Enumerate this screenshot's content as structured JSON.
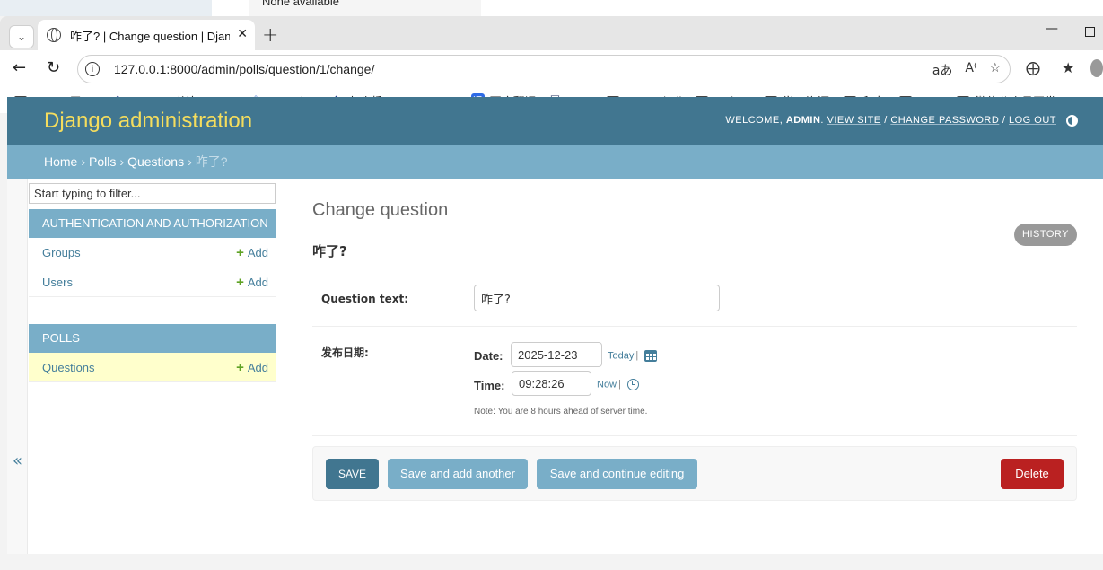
{
  "background": {
    "text": "None available"
  },
  "browser": {
    "tab_title": "咋了? | Change question | Django",
    "url": "127.0.0.1:8000/admin/polls/question/1/change/",
    "bookmarks": [
      {
        "label": "Atos",
        "icon": "folder-icon"
      },
      {
        "label": "",
        "icon": "storage-icon"
      },
      {
        "label": "Percipio 书籍 Wind...",
        "icon": "percipio-icon"
      },
      {
        "label": "EasyChat",
        "icon": "easychat-icon"
      },
      {
        "label": "专业版Windows Po...",
        "icon": "diamond-icon"
      },
      {
        "label": "百度翻译",
        "icon": "translate-icon"
      },
      {
        "label": "Nova",
        "icon": "shield-icon"
      },
      {
        "label": "Powershell",
        "icon": "folder-icon"
      },
      {
        "label": "Python",
        "icon": "folder-icon"
      },
      {
        "label": "学习资源",
        "icon": "folder-icon"
      },
      {
        "label": "爬虫",
        "icon": "folder-icon"
      },
      {
        "label": "DOS",
        "icon": "folder-icon"
      },
      {
        "label": "微信公众号开发",
        "icon": "folder-icon"
      }
    ]
  },
  "header": {
    "brand": "Django administration",
    "welcome": "WELCOME, ",
    "user": "ADMIN",
    "view_site": "VIEW SITE",
    "change_password": "CHANGE PASSWORD",
    "log_out": "LOG OUT",
    "colors": {
      "header_bg": "#417690",
      "brand": "#f5dd5d",
      "breadcrumb_bg": "#79aec8"
    }
  },
  "breadcrumbs": {
    "home": "Home",
    "polls": "Polls",
    "questions": "Questions",
    "current": "咋了?"
  },
  "sidebar": {
    "filter_placeholder": "Start typing to filter...",
    "toggle": "«",
    "modules": [
      {
        "caption": "AUTHENTICATION AND AUTHORIZATION",
        "models": [
          {
            "name": "Groups",
            "add": "Add"
          },
          {
            "name": "Users",
            "add": "Add"
          }
        ]
      },
      {
        "caption": "POLLS",
        "models": [
          {
            "name": "Questions",
            "add": "Add"
          }
        ]
      }
    ]
  },
  "content": {
    "title": "Change question",
    "object_title": "咋了?",
    "history": "HISTORY",
    "question_text_label": "Question text:",
    "question_text_value": "咋了?",
    "pub_date_label": "发布日期:",
    "date_label": "Date:",
    "date_value": "2025-12-23",
    "today": "Today",
    "time_label": "Time:",
    "time_value": "09:28:26",
    "now": "Now",
    "note": "Note: You are 8 hours ahead of server time."
  },
  "actions": {
    "save": "SAVE",
    "save_add_another": "Save and add another",
    "save_continue": "Save and continue editing",
    "delete": "Delete"
  }
}
